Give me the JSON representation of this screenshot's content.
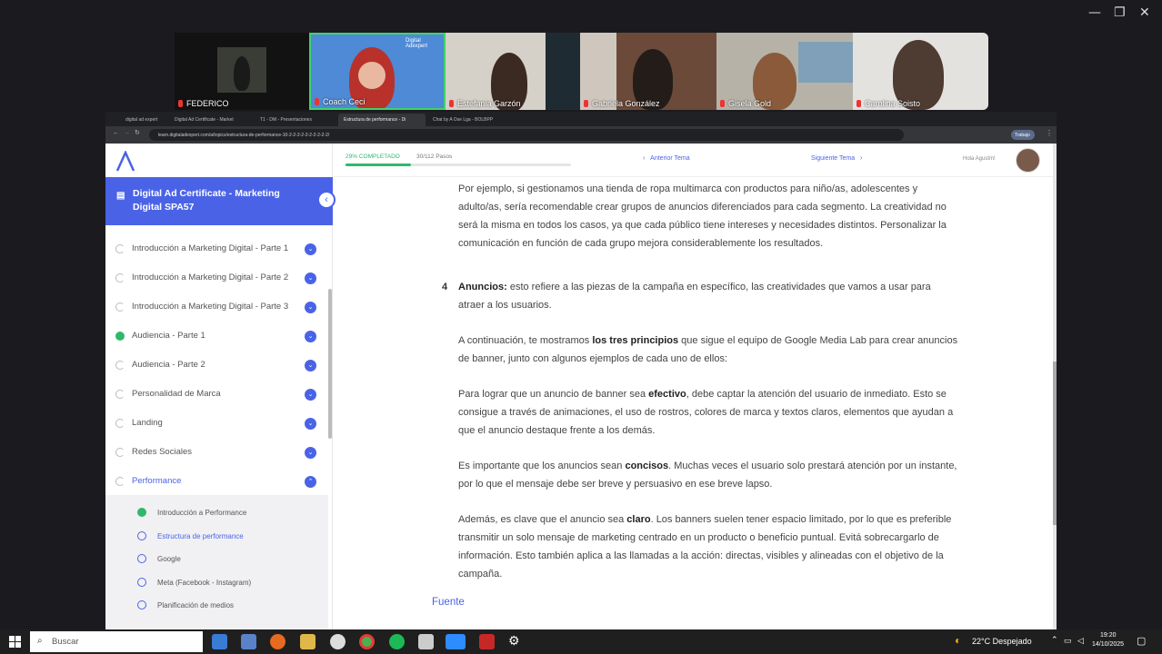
{
  "window_controls": {
    "minimize": "—",
    "restore": "❐",
    "close": "✕"
  },
  "participants": [
    {
      "name": "FEDERICO"
    },
    {
      "name": "Coach Ceci",
      "overlay": "Digital Adexpert"
    },
    {
      "name": "Estefania Garzón"
    },
    {
      "name": "Gabriela González"
    },
    {
      "name": "Gisela Gold"
    },
    {
      "name": "Carolina Soisto"
    }
  ],
  "browser": {
    "tabs": [
      "digital ad expert",
      "Digital Ad Certificate - Market",
      "T1 - DM - Presentaciones",
      "Estructura de performance - Di",
      "Chat by A Ose Lga - BOLBPP"
    ],
    "url": "learn.digitaladexpert.com/a/topics/estructura-de-performance-10-2-2-2-2-2-2-2-2-2-2/",
    "profile": "Trabajo"
  },
  "header": {
    "progress_text": "29% COMPLETADO",
    "progress_steps": "30/112 Pasos",
    "progress_fraction": 0.29,
    "prev_topic": "Anterior Tema",
    "next_topic": "Siguiente Tema",
    "greeting": "Hola Agustín!"
  },
  "sidebar": {
    "course_title": "Digital Ad Certificate - Marketing Digital SPA57",
    "modules": [
      {
        "label": "Introducción a Marketing Digital - Parte 1",
        "done": false
      },
      {
        "label": "Introducción a Marketing Digital - Parte 2",
        "done": false
      },
      {
        "label": "Introducción a Marketing Digital - Parte 3",
        "done": false
      },
      {
        "label": "Audiencia - Parte 1",
        "done": true
      },
      {
        "label": "Audiencia - Parte 2",
        "done": false
      },
      {
        "label": "Personalidad de Marca",
        "done": false
      },
      {
        "label": "Landing",
        "done": false
      },
      {
        "label": "Redes Sociales",
        "done": false
      },
      {
        "label": "Performance",
        "done": false,
        "active": true
      }
    ],
    "subtopics": [
      {
        "label": "Introducción a Performance",
        "done": true
      },
      {
        "label": "Estructura de performance",
        "active": true
      },
      {
        "label": "Google"
      },
      {
        "label": "Meta (Facebook - Instagram)"
      },
      {
        "label": "Planificación de medios"
      }
    ]
  },
  "content": {
    "para1": "Por ejemplo, si gestionamos una tienda de ropa multimarca con productos para niño/as, adolescentes y adulto/as, sería recomendable crear grupos de anuncios diferenciados para cada segmento. La creatividad no será la misma en todos los casos, ya que cada público tiene intereses y necesidades distintos. Personalizar la comunicación en función de cada grupo mejora considerablemente los resultados.",
    "item_number": "4",
    "item_title": "Anuncios:",
    "item_text": " esto refiere a las piezas de la campaña en específico, las creatividades que vamos a usar para atraer a los usuarios.",
    "p2_a": "A continuación, te mostramos ",
    "p2_b": "los tres principios",
    "p2_c": " que sigue el equipo de Google Media Lab para crear anuncios de banner, junto con algunos ejemplos de cada uno de ellos:",
    "p3_a": "Para lograr que un anuncio de banner sea ",
    "p3_b": "efectivo",
    "p3_c": ", debe captar la atención del usuario de inmediato. Esto se consigue a través de animaciones, el uso de rostros, colores de marca y textos claros, elementos que ayudan a que el anuncio destaque frente a los demás.",
    "p4_a": "Es importante que los anuncios sean ",
    "p4_b": "concisos",
    "p4_c": ". Muchas veces el usuario solo prestará atención por un instante, por lo que el mensaje debe ser breve y persuasivo en ese breve lapso.",
    "p5_a": "Además, es clave que el anuncio sea ",
    "p5_b": "claro",
    "p5_c": ". Los banners suelen tener espacio limitado, por lo que es preferible transmitir un solo mensaje de marketing centrado en un producto o beneficio puntual. Evitá sobrecargarlo de información. Esto también aplica a las llamadas a la acción: directas, visibles y alineadas con el objetivo de la campaña.",
    "source_label": "Fuente"
  },
  "taskbar": {
    "search_placeholder": "Buscar",
    "weather": "22°C  Despejado",
    "time": "19:20",
    "date": "14/10/2025"
  },
  "colors": {
    "accent": "#4a63e6",
    "done": "#2fb86b",
    "zoom_bg": "#1b1b1f"
  }
}
